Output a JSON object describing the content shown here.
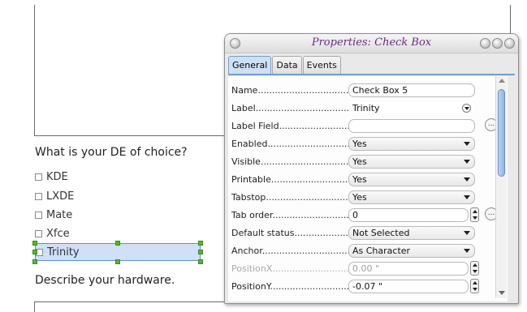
{
  "document": {
    "question1": "What is your DE of choice?",
    "options": [
      "KDE",
      "LXDE",
      "Mate",
      "Xfce",
      "Trinity"
    ],
    "question2": "Describe your hardware."
  },
  "dialog": {
    "title": "Properties: Check Box",
    "tabs": [
      "General",
      "Data",
      "Events"
    ],
    "active_tab": "General",
    "icons": [
      "window-menu-icon",
      "minimize-icon",
      "maximize-icon",
      "close-icon"
    ],
    "fields": [
      {
        "label": "Name",
        "value": "Check Box 5"
      },
      {
        "label": "Label",
        "value": "Trinity"
      },
      {
        "label": "Label Field",
        "value": ""
      },
      {
        "label": "Enabled",
        "value": "Yes"
      },
      {
        "label": "Visible",
        "value": "Yes"
      },
      {
        "label": "Printable",
        "value": "Yes"
      },
      {
        "label": "Tabstop",
        "value": "Yes"
      },
      {
        "label": "Tab order",
        "value": "0"
      },
      {
        "label": "Default status",
        "value": "Not Selected"
      },
      {
        "label": "Anchor",
        "value": "As Character"
      },
      {
        "label": "PositionX",
        "value": "0.00 \""
      },
      {
        "label": "PositionY",
        "value": "-0.07 \""
      }
    ],
    "dots_label": "..."
  },
  "colors": {
    "accent": "#6f9fd6",
    "selection": "#cfe0f7",
    "handle": "#59b52c",
    "title": "#6a2a86"
  }
}
